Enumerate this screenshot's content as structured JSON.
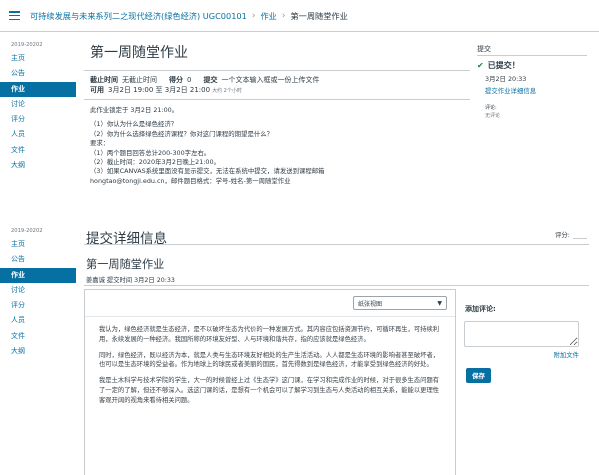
{
  "breadcrumb": {
    "course": "可持续发展与未来系列二之现代经济(绿色经济) UGC00101",
    "section": "作业",
    "current": "第一周随堂作业"
  },
  "nav_top": {
    "term": "2019-20202",
    "items": [
      "主页",
      "公告",
      "作业",
      "讨论",
      "评分",
      "人员",
      "文件",
      "大纲"
    ],
    "active": "作业"
  },
  "nav_bottom": {
    "term": "2019-20202",
    "items": [
      "主页",
      "公告",
      "作业",
      "讨论",
      "评分",
      "人员",
      "文件",
      "大纲"
    ],
    "active": "作业"
  },
  "assignment": {
    "title": "第一周随堂作业",
    "due_label": "截止时间",
    "due_value": "无截止时间",
    "points_label": "得分",
    "points_value": "0",
    "submit_label": "提交",
    "submit_value": "一个文本输入框或一份上传文件",
    "available_label": "可用",
    "available_value": "3月2日 19:00 至 3月2日 21:00",
    "available_note": "大约 2个小时",
    "description": [
      "此作业锁定于 3月2日 21:00。",
      "",
      "（1）你认为什么是绿色经济？",
      "（2）你为什么选择绿色经济课程？你对这门课程的期望是什么？",
      "要求：",
      "（1）两个题目回答总计200-300字左右。",
      "（2）截止时间：2020年3月2日晚上21:00。",
      "（3）如果CANVAS系统里面没有显示提交，无法在系统中提交，请发送到课程邮箱",
      "hongtao@tongji.edu.cn，邮件题目格式：学号-姓名-第一周随堂作业"
    ]
  },
  "submission_sidebar": {
    "title": "提交",
    "status": "已提交！",
    "date": "3月2日 20:33",
    "details_link": "提交作业详细信息",
    "comments_label": "评论:",
    "comments_value": "无评论"
  },
  "details": {
    "page_title": "提交详细信息",
    "grade_label": "评分:",
    "assignment_title": "第一周随堂作业",
    "byline": "姜嘉诚 提交时间 3月2日 20:33",
    "view_select": "纸张视图",
    "paragraphs": [
      "我认为，绿色经济就是生态经济，是不以破坏生态为代价的一种发展方式。其内容应包括资源节约，可循环再生，可持续利用，永续发展的一种经济。我国所称的环境友好型、人与环境和谐共存，指的应该就是绿色经济。",
      "同时，绿色经济，既以经济为本，就是人类与生态环境友好相处的生产生活活动。人人都是生态环境的影响者甚至破坏者，也可以是生态环境的受益者。作为地球上的球民或者美丽的国民，首先得数到是绿色经济，才能享受到绿色经济的好处。",
      "我是土木科学与技术学院的学生，大一的时候曾经上过《生态学》这门课，在学习和完成作业的时候，对于很多生态问题有了一定的了解，但还不够深入。选这门课的话，是想有一个机会可以了解学习到生态与人类活动的相互关系，能能以更理性客观开阔的视角来看待相关问题。"
    ],
    "comment_label": "添加评论:",
    "attach_label": "附加文件",
    "save_label": "保存"
  },
  "colors": {
    "link": "#0770a3",
    "text": "#2d3b45",
    "success": "#0b874b",
    "border": "#c7cdd1"
  }
}
